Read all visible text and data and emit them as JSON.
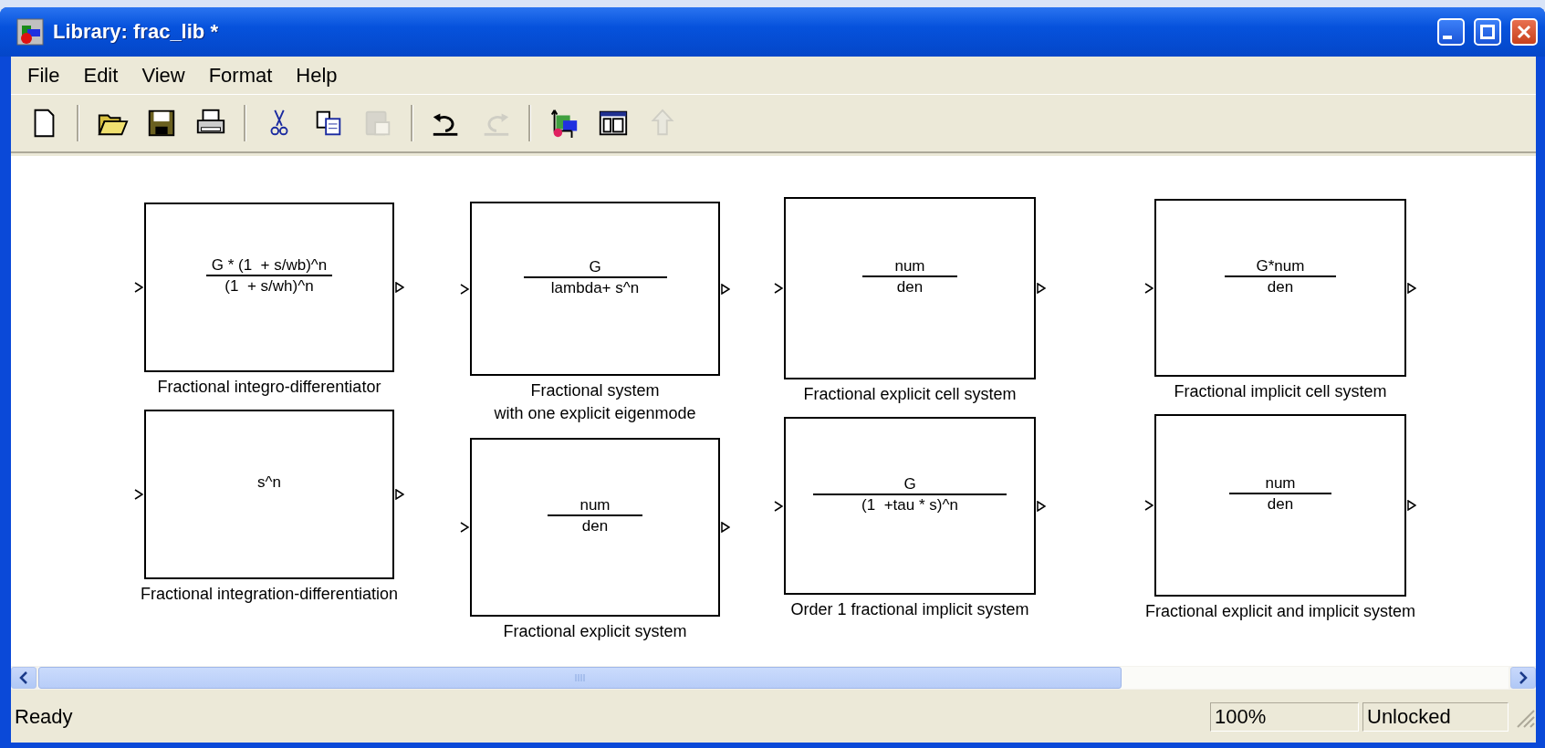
{
  "window": {
    "title": "Library: frac_lib *"
  },
  "menu": [
    "File",
    "Edit",
    "View",
    "Format",
    "Help"
  ],
  "toolbar": [
    {
      "kind": "new",
      "disabled": false
    },
    {
      "kind": "separator"
    },
    {
      "kind": "open",
      "disabled": false
    },
    {
      "kind": "save",
      "disabled": false
    },
    {
      "kind": "print",
      "disabled": false
    },
    {
      "kind": "separator"
    },
    {
      "kind": "cut",
      "disabled": false
    },
    {
      "kind": "copy",
      "disabled": false
    },
    {
      "kind": "paste",
      "disabled": true
    },
    {
      "kind": "separator"
    },
    {
      "kind": "undo",
      "disabled": false
    },
    {
      "kind": "redo",
      "disabled": true
    },
    {
      "kind": "separator"
    },
    {
      "kind": "library",
      "disabled": false
    },
    {
      "kind": "browser",
      "disabled": false
    },
    {
      "kind": "up",
      "disabled": true
    }
  ],
  "blocks": [
    {
      "kind": "fraction",
      "numerator": "G * (1  + s/wb)^n",
      "denominator": "(1  + s/wh)^n",
      "label": "Fractional integro-differentiator"
    },
    {
      "kind": "fraction",
      "numerator": "G",
      "denominator": "lambda+ s^n",
      "label": "Fractional system\nwith one explicit eigenmode"
    },
    {
      "kind": "fraction",
      "numerator": "num",
      "denominator": "den",
      "label": "Fractional explicit cell system"
    },
    {
      "kind": "fraction",
      "numerator": "G*num",
      "denominator": "den",
      "label": "Fractional implicit cell system"
    },
    {
      "kind": "expression",
      "expression": "s^n",
      "label": "Fractional integration-differentiation"
    },
    {
      "kind": "fraction",
      "numerator": "num",
      "denominator": "den",
      "label": "Fractional explicit system"
    },
    {
      "kind": "fraction",
      "numerator": "G",
      "denominator": "(1  +tau * s)^n",
      "label": "Order 1 fractional implicit system"
    },
    {
      "kind": "fraction",
      "numerator": "num",
      "denominator": "den",
      "label": "Fractional explicit and implicit system"
    }
  ],
  "status_bar": {
    "message": "Ready",
    "zoom": "100%",
    "lock": "Unlocked"
  }
}
